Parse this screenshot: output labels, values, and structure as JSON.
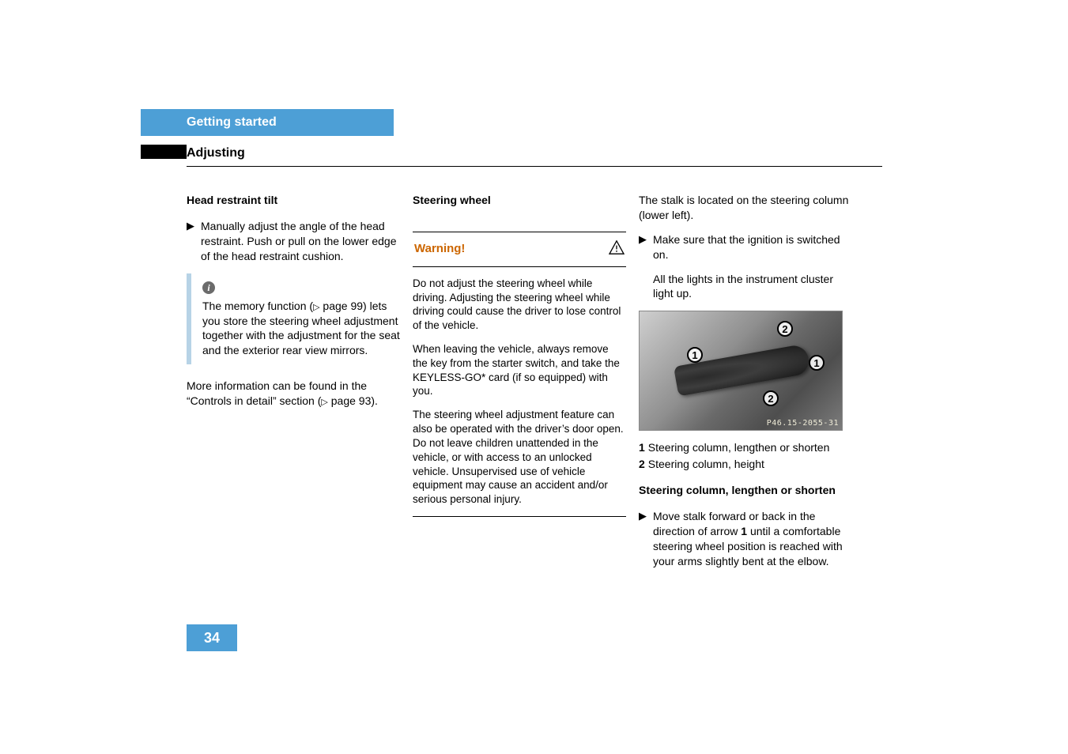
{
  "chapter": "Getting started",
  "section": "Adjusting",
  "page_number": "34",
  "col1": {
    "heading": "Head restraint tilt",
    "bullet1": "Manually adjust the angle of the head restraint. Push or pull on the lower edge of the head restraint cushion.",
    "info_text_a": "The memory function (",
    "info_page": " page 99) lets you store the steering wheel adjustment together with the adjustment for the seat and the exterior rear view mirrors.",
    "foot_a": "More information can be found in the “Controls in detail” section (",
    "foot_b": " page 93)."
  },
  "col2": {
    "heading": "Steering wheel",
    "warning_label": "Warning!",
    "warn_p1": "Do not adjust the steering wheel while driving. Adjusting the steering wheel while driving could cause the driver to lose control of the vehicle.",
    "warn_p2": "When leaving the vehicle, always remove the key from the starter switch, and take the KEYLESS-GO* card (if so equipped) with you.",
    "warn_p3": "The steering wheel adjustment feature can also be operated with the driver’s door open. Do not leave children unattended in the vehicle, or with access to an unlocked vehicle. Unsupervised use of vehicle equipment may cause an accident and/or serious personal injury."
  },
  "col3": {
    "intro": "The stalk is located on the steering column (lower left).",
    "bullet1": "Make sure that the ignition is switched on.",
    "sub1": "All the lights in the instrument cluster light up.",
    "fig_pnum": "P46.15-2055-31",
    "legend1_num": "1",
    "legend1_txt": "Steering column, lengthen or shorten",
    "legend2_num": "2",
    "legend2_txt": "Steering column, height",
    "heading2": "Steering column, lengthen or shorten",
    "bullet2_a": "Move stalk forward or back in the direction of arrow ",
    "bullet2_num": "1",
    "bullet2_b": " until a comfortable steering wheel position is reached with your arms slightly bent at the elbow."
  }
}
